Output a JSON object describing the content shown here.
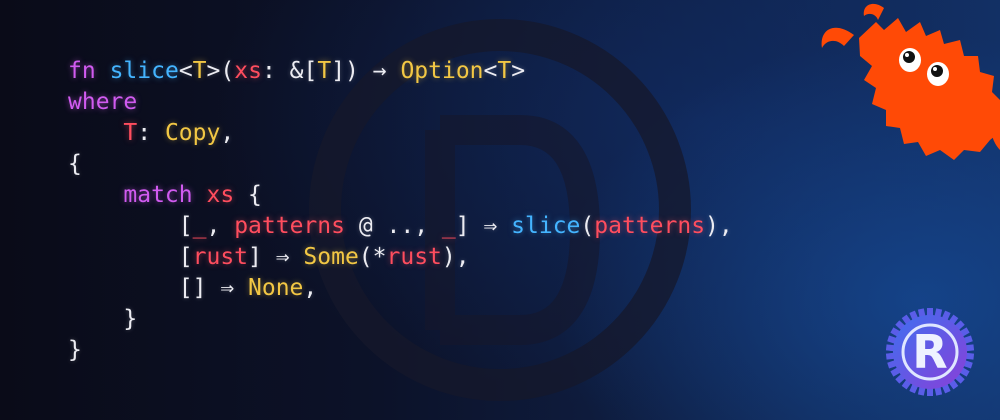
{
  "colors": {
    "keyword": "#d15bf0",
    "type": "#f2c744",
    "function": "#44b4ff",
    "variable": "#ff4d5e",
    "punctuation": "#ececf2",
    "ferris": "#ff4a06",
    "rust_logo": "#5a5de8"
  },
  "icons": {
    "watermark": "dev-logo-watermark-icon",
    "mascot": "ferris-crab-icon",
    "logo": "rust-logo-icon"
  },
  "rust_logo_letter": "R",
  "code_lines": [
    [
      {
        "c": "kw",
        "t": "fn"
      },
      {
        "c": "pu",
        "t": " "
      },
      {
        "c": "fn",
        "t": "slice"
      },
      {
        "c": "pu",
        "t": "<"
      },
      {
        "c": "ty",
        "t": "T"
      },
      {
        "c": "pu",
        "t": ">("
      },
      {
        "c": "var",
        "t": "xs"
      },
      {
        "c": "pu",
        "t": ": &["
      },
      {
        "c": "ty",
        "t": "T"
      },
      {
        "c": "pu",
        "t": "]) → "
      },
      {
        "c": "ty",
        "t": "Option"
      },
      {
        "c": "pu",
        "t": "<"
      },
      {
        "c": "ty",
        "t": "T"
      },
      {
        "c": "pu",
        "t": ">"
      }
    ],
    [
      {
        "c": "kw",
        "t": "where"
      }
    ],
    [
      {
        "c": "pu",
        "t": "    "
      },
      {
        "c": "var",
        "t": "T"
      },
      {
        "c": "pu",
        "t": ": "
      },
      {
        "c": "ty",
        "t": "Copy"
      },
      {
        "c": "pu",
        "t": ","
      }
    ],
    [
      {
        "c": "pu",
        "t": "{"
      }
    ],
    [
      {
        "c": "pu",
        "t": "    "
      },
      {
        "c": "kw",
        "t": "match"
      },
      {
        "c": "pu",
        "t": " "
      },
      {
        "c": "var",
        "t": "xs"
      },
      {
        "c": "pu",
        "t": " {"
      }
    ],
    [
      {
        "c": "pu",
        "t": "        ["
      },
      {
        "c": "var",
        "t": "_"
      },
      {
        "c": "pu",
        "t": ", "
      },
      {
        "c": "var",
        "t": "patterns"
      },
      {
        "c": "pu",
        "t": " @ .., "
      },
      {
        "c": "var",
        "t": "_"
      },
      {
        "c": "pu",
        "t": "] ⇒ "
      },
      {
        "c": "fn",
        "t": "slice"
      },
      {
        "c": "pu",
        "t": "("
      },
      {
        "c": "var",
        "t": "patterns"
      },
      {
        "c": "pu",
        "t": "),"
      }
    ],
    [
      {
        "c": "pu",
        "t": "        ["
      },
      {
        "c": "var",
        "t": "rust"
      },
      {
        "c": "pu",
        "t": "] ⇒ "
      },
      {
        "c": "ty",
        "t": "Some"
      },
      {
        "c": "pu",
        "t": "(*"
      },
      {
        "c": "var",
        "t": "rust"
      },
      {
        "c": "pu",
        "t": "),"
      }
    ],
    [
      {
        "c": "pu",
        "t": "        [] ⇒ "
      },
      {
        "c": "ty",
        "t": "None"
      },
      {
        "c": "pu",
        "t": ","
      }
    ],
    [
      {
        "c": "pu",
        "t": "    }"
      }
    ],
    [
      {
        "c": "pu",
        "t": "}"
      }
    ]
  ]
}
